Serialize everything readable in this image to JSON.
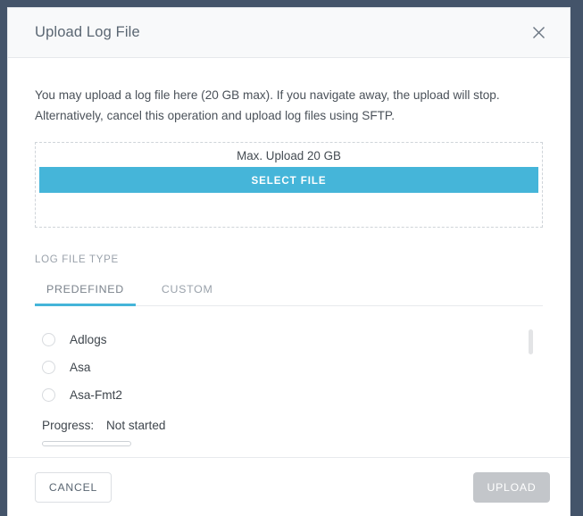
{
  "colors": {
    "backdrop": "#44546a",
    "accent": "#45b5d9",
    "header_bg": "#f8f9fa",
    "disabled_button": "#c3c6ca",
    "text": "#3f464d",
    "muted_text": "#9aa2ab"
  },
  "dialog": {
    "title": "Upload Log File",
    "close_icon": "close-icon"
  },
  "body": {
    "description_line1": "You may upload a log file here (20 GB max). If you navigate away, the upload will stop.",
    "description_line2": "Alternatively, cancel this operation and upload log files using SFTP.",
    "dropzone": {
      "max_label": "Max. Upload 20 GB",
      "select_file_label": "SELECT FILE"
    },
    "log_file_type": {
      "section_label": "LOG FILE TYPE",
      "tabs": [
        {
          "label": "PREDEFINED",
          "active": true
        },
        {
          "label": "CUSTOM",
          "active": false
        }
      ],
      "options": [
        {
          "label": "Adlogs",
          "selected": false
        },
        {
          "label": "Asa",
          "selected": false
        },
        {
          "label": "Asa-Fmt2",
          "selected": false
        }
      ]
    },
    "progress": {
      "label": "Progress:",
      "value": "Not started",
      "percent": 0
    }
  },
  "footer": {
    "cancel_label": "CANCEL",
    "upload_label": "UPLOAD"
  }
}
